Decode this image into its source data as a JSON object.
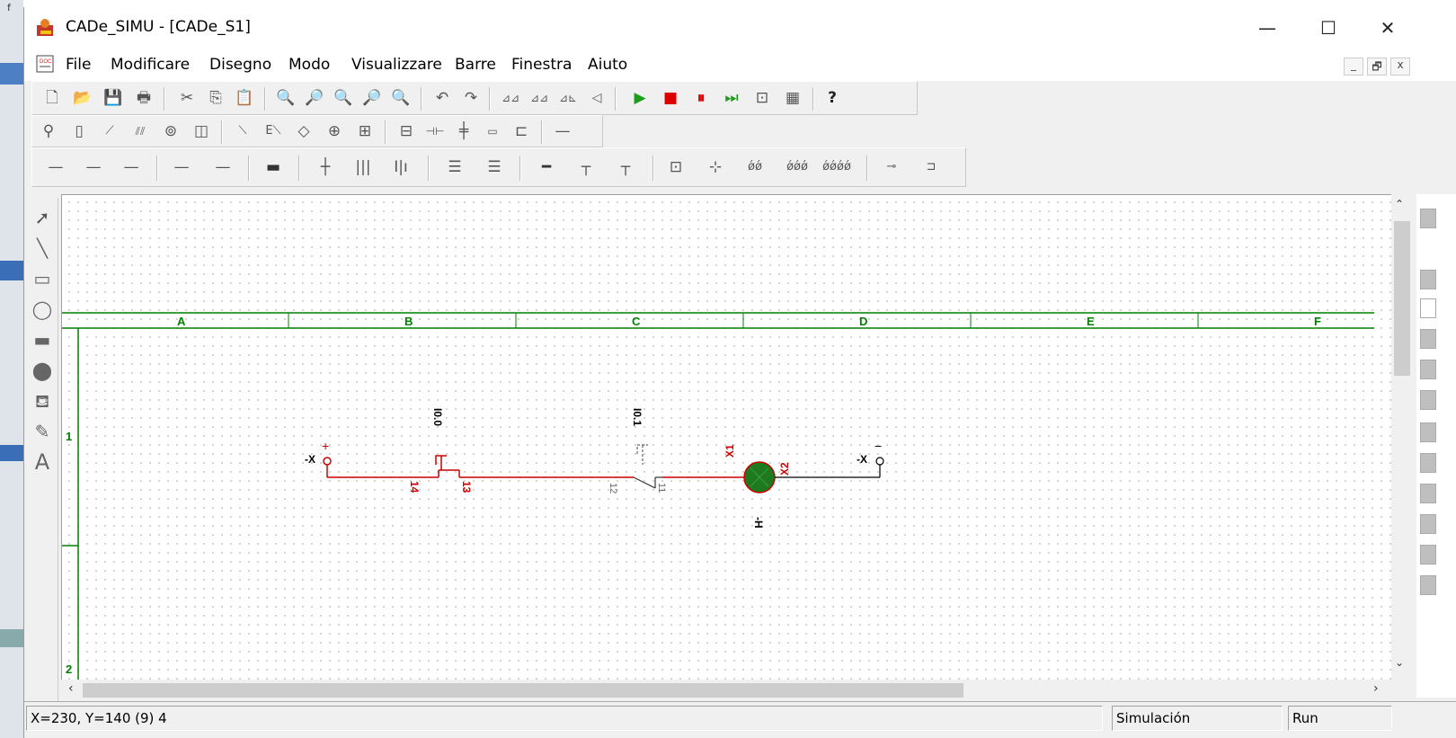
{
  "window": {
    "title": "CADe_SIMU - [CADe_S1]",
    "controls": {
      "minimize": "—",
      "maximize": "☐",
      "close": "✕"
    }
  },
  "menu": [
    "File",
    "Modificare",
    "Disegno",
    "Modo",
    "Visualizzare",
    "Barre",
    "Finestra",
    "Aiuto"
  ],
  "mdi_controls": {
    "minimize": "_",
    "restore": "🗗",
    "close": "x"
  },
  "toolbar": {
    "help_glyph": "?"
  },
  "sheet": {
    "columns": [
      "A",
      "B",
      "C",
      "D",
      "E",
      "F"
    ],
    "rows": [
      "1",
      "2"
    ]
  },
  "schematic": {
    "left_terminal_label": "-X",
    "left_terminal_sign": "+",
    "right_terminal_label": "-X",
    "right_terminal_sign": "−",
    "contact1": {
      "tag": "I0.0",
      "pin_a": "14",
      "pin_b": "13"
    },
    "contact2": {
      "tag": "I0.1",
      "pin_a": "12",
      "pin_b": "11"
    },
    "lamp": {
      "pin_a": "X1",
      "pin_b": "X2",
      "tag": "-H"
    },
    "colors": {
      "wire_active": "#cc0000",
      "wire_passive": "#000000",
      "lamp_fill": "#1e7a1e",
      "grid": "#008000"
    }
  },
  "status": {
    "coords": "X=230, Y=140 (9) 4",
    "mode": "Simulación",
    "run": "Run"
  }
}
